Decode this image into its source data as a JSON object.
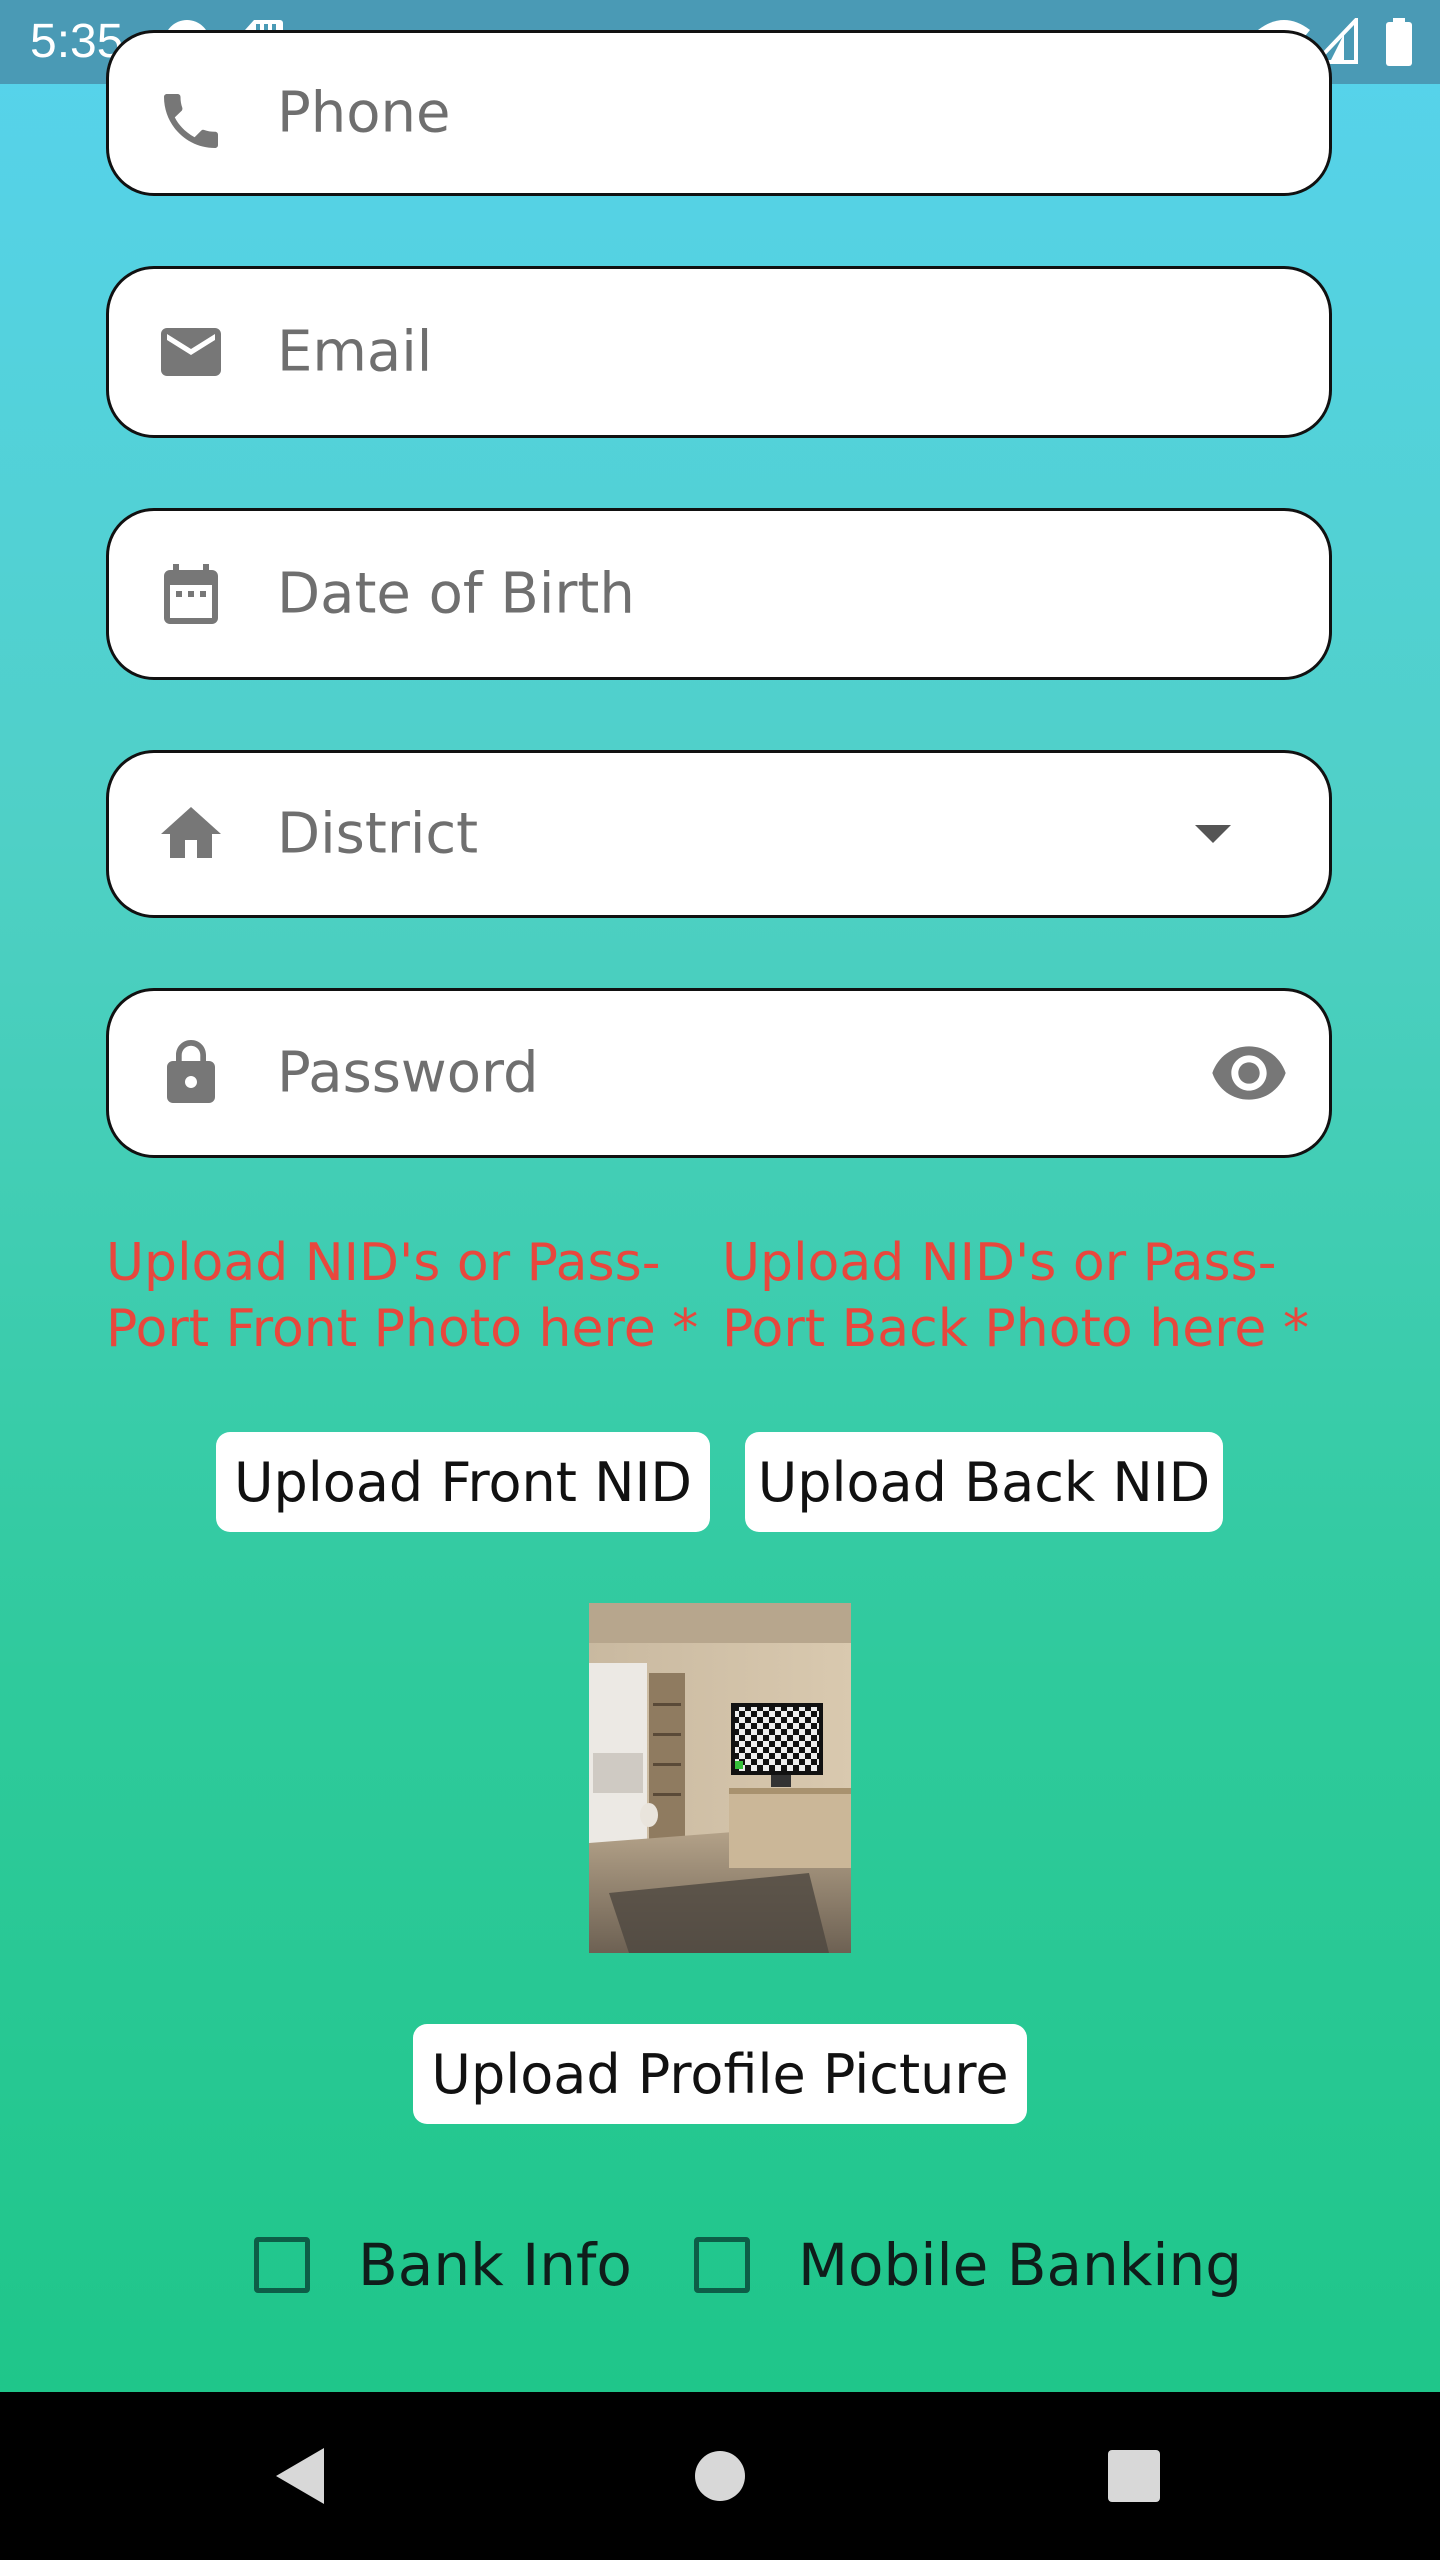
{
  "status_bar": {
    "time": "5:35"
  },
  "form": {
    "phone_placeholder": "Phone",
    "email_placeholder": "Email",
    "dob_placeholder": "Date of Birth",
    "district_placeholder": "District",
    "password_placeholder": "Password"
  },
  "upload": {
    "front_note_line1": "Upload NID's or Pass-",
    "front_note_line2": "Port Front Photo here *",
    "back_note_line1": "Upload NID's or Pass-",
    "back_note_line2": "Port Back Photo here *",
    "front_button": "Upload Front NID",
    "back_button": "Upload Back NID",
    "profile_button": "Upload Profile Picture"
  },
  "options": {
    "bank_info": "Bank Info",
    "mobile_banking": "Mobile Banking"
  },
  "colors": {
    "error_text": "#e8473d",
    "status_bar": "#4a9ab5",
    "gradient_top": "#57d3ee",
    "gradient_bottom": "#1fc68a"
  }
}
